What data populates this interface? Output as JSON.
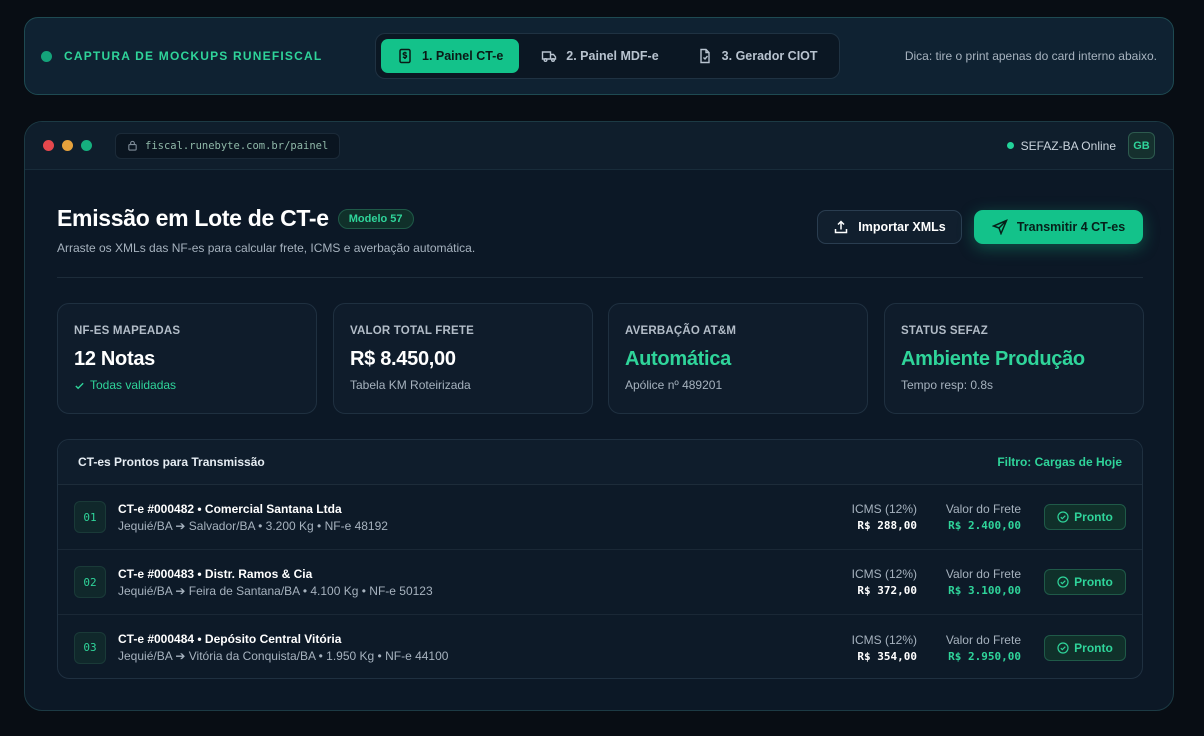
{
  "topbar": {
    "brand": "CAPTURA DE MOCKUPS RUNEFISCAL",
    "tabs": [
      {
        "label": "1. Painel CT-e",
        "icon": "receipt-icon"
      },
      {
        "label": "2. Painel MDF-e",
        "icon": "truck-icon"
      },
      {
        "label": "3. Gerador CIOT",
        "icon": "file-icon"
      }
    ],
    "tip": "Dica: tire o print apenas do card interno abaixo."
  },
  "browser": {
    "url": "fiscal.runebyte.com.br/painel",
    "status": "SEFAZ-BA Online",
    "avatar": "GB",
    "dot_colors": [
      "#e5484d",
      "#e6a23c",
      "#16b07e"
    ]
  },
  "header": {
    "title": "Emissão em Lote de CT-e",
    "badge": "Modelo 57",
    "subtitle": "Arraste os XMLs das NF-es para calcular frete, ICMS e averbação automática.",
    "import_label": "Importar XMLs",
    "send_label": "Transmitir 4 CT-es"
  },
  "stats": [
    {
      "label": "NF-ES MAPEADAS",
      "value": "12 Notas",
      "sub": "Todas validadas"
    },
    {
      "label": "VALOR TOTAL FRETE",
      "value": "R$ 8.450,00",
      "sub": "Tabela KM Roteirizada"
    },
    {
      "label": "AVERBAÇÃO AT&M",
      "value": "Automática",
      "sub": "Apólice nº 489201"
    },
    {
      "label": "STATUS SEFAZ",
      "value": "Ambiente Produção",
      "sub": "Tempo resp: 0.8s"
    }
  ],
  "table": {
    "title": "CT-es Prontos para Transmissão",
    "filter": "Filtro: Cargas de Hoje",
    "icms_label": "ICMS (12%)",
    "frete_label": "Valor do Frete",
    "status_label": "Pronto",
    "rows": [
      {
        "num": "01",
        "title": "CT-e #000482 • Comercial Santana Ltda",
        "sub": "Jequié/BA ➔ Salvador/BA • 3.200 Kg • NF-e 48192",
        "icms": "R$ 288,00",
        "frete": "R$ 2.400,00"
      },
      {
        "num": "02",
        "title": "CT-e #000483 • Distr. Ramos & Cia",
        "sub": "Jequié/BA ➔ Feira de Santana/BA • 4.100 Kg • NF-e 50123",
        "icms": "R$ 372,00",
        "frete": "R$ 3.100,00"
      },
      {
        "num": "03",
        "title": "CT-e #000484 • Depósito Central Vitória",
        "sub": "Jequié/BA ➔ Vitória da Conquista/BA • 1.950 Kg • NF-e 44100",
        "icms": "R$ 354,00",
        "frete": "R$ 2.950,00"
      }
    ]
  },
  "colors": {
    "accent": "#13c28a",
    "accent_text": "#2fd49a",
    "background": "#080d14"
  }
}
